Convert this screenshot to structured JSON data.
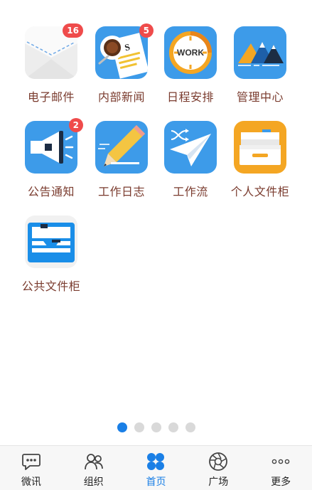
{
  "apps": [
    {
      "label": "电子邮件",
      "icon": "mail-icon",
      "badge": "16"
    },
    {
      "label": "内部新闻",
      "icon": "news-icon",
      "badge": "5"
    },
    {
      "label": "日程安排",
      "icon": "schedule-icon",
      "badge": null
    },
    {
      "label": "管理中心",
      "icon": "mountain-icon",
      "badge": null
    },
    {
      "label": "公告通知",
      "icon": "megaphone-icon",
      "badge": "2"
    },
    {
      "label": "工作日志",
      "icon": "pencil-icon",
      "badge": null
    },
    {
      "label": "工作流",
      "icon": "paper-plane-icon",
      "badge": null
    },
    {
      "label": "个人文件柜",
      "icon": "file-tray-icon",
      "badge": null
    },
    {
      "label": "公共文件柜",
      "icon": "cabinet-icon",
      "badge": null
    }
  ],
  "news_icon_text": "N'S",
  "work_icon_text": "WORK",
  "pager": {
    "count": 5,
    "active_index": 0
  },
  "tabbar": {
    "items": [
      {
        "label": "微讯",
        "icon": "chat-icon",
        "active": false
      },
      {
        "label": "组织",
        "icon": "people-icon",
        "active": false
      },
      {
        "label": "首页",
        "icon": "home-grid-icon",
        "active": true
      },
      {
        "label": "广场",
        "icon": "aperture-icon",
        "active": false
      },
      {
        "label": "更多",
        "icon": "more-icon",
        "active": false
      }
    ]
  },
  "colors": {
    "accent": "#1a7fe6",
    "badge": "#ef4b4b",
    "label": "#7a3b2e",
    "icon_blue": "#3d9be9",
    "icon_orange": "#f4a623"
  }
}
